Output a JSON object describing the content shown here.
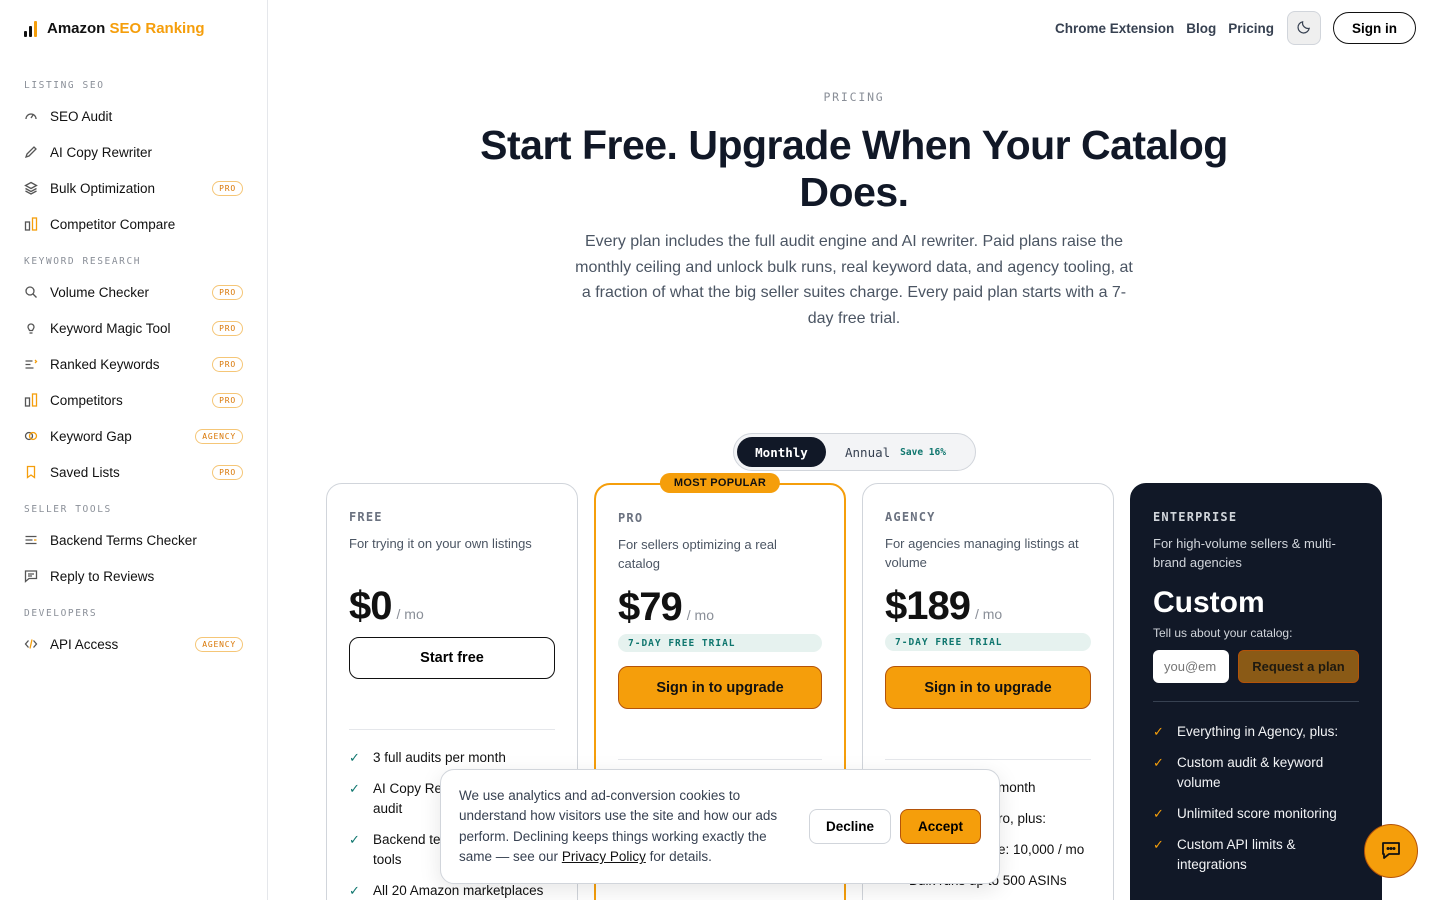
{
  "brand": {
    "name": "Amazon",
    "accent": "SEO Ranking",
    "accent_color": "#f59e0b"
  },
  "sidebar": {
    "sections": [
      {
        "label": "LISTING SEO"
      },
      {
        "label": "KEYWORD RESEARCH"
      },
      {
        "label": "SELLER TOOLS"
      },
      {
        "label": "DEVELOPERS"
      }
    ],
    "items": [
      {
        "label": "SEO Audit",
        "icon": "gauge-icon",
        "badge": ""
      },
      {
        "label": "AI Copy Rewriter",
        "icon": "pencil-icon",
        "badge": ""
      },
      {
        "label": "Bulk Optimization",
        "icon": "layers-icon",
        "badge": "PRO"
      },
      {
        "label": "Competitor Compare",
        "icon": "compare-icon",
        "badge": ""
      },
      {
        "label": "Volume Checker",
        "icon": "search-icon",
        "badge": "PRO"
      },
      {
        "label": "Keyword Magic Tool",
        "icon": "lightbulb-icon",
        "badge": "PRO"
      },
      {
        "label": "Ranked Keywords",
        "icon": "list-ranked-icon",
        "badge": "PRO"
      },
      {
        "label": "Competitors",
        "icon": "compare-icon",
        "badge": "PRO"
      },
      {
        "label": "Keyword Gap",
        "icon": "venn-icon",
        "badge": "AGENCY"
      },
      {
        "label": "Saved Lists",
        "icon": "bookmark-icon",
        "badge": "PRO"
      },
      {
        "label": "Backend Terms Checker",
        "icon": "terms-icon",
        "badge": ""
      },
      {
        "label": "Reply to Reviews",
        "icon": "message-icon",
        "badge": ""
      },
      {
        "label": "API Access",
        "icon": "code-icon",
        "badge": "AGENCY"
      }
    ]
  },
  "topnav": {
    "links": [
      "Chrome Extension",
      "Blog",
      "Pricing"
    ],
    "theme_icon": "moon-icon",
    "signin": "Sign in"
  },
  "hero": {
    "eyebrow": "PRICING",
    "title": "Start Free. Upgrade When Your Catalog Does.",
    "subtitle": "Every plan includes the full audit engine and AI rewriter. Paid plans raise the monthly ceiling and unlock bulk runs, real keyword data, and agency tooling, at a fraction of what the big seller suites charge. Every paid plan starts with a 7-day free trial."
  },
  "billing": {
    "monthly": "Monthly",
    "annual": "Annual",
    "save": "Save 16%",
    "selected": "Monthly"
  },
  "plans": {
    "free": {
      "name": "FREE",
      "desc": "For trying it on your own listings",
      "price": "$0",
      "per": "/ mo",
      "cta": "Start free",
      "features": [
        "3 full audits per month",
        "AI Copy Rewriter with each audit",
        "Backend terms & review reply tools",
        "All 20 Amazon marketplaces"
      ]
    },
    "pro": {
      "popular": "MOST POPULAR",
      "name": "PRO",
      "desc": "For sellers optimizing a real catalog",
      "price": "$79",
      "per": "/ mo",
      "trial": "7-DAY FREE TRIAL",
      "cta": "Sign in to upgrade"
    },
    "agency": {
      "name": "AGENCY",
      "desc": "For agencies managing listings at volume",
      "price": "$189",
      "per": "/ mo",
      "trial": "7-DAY FREE TRIAL",
      "cta": "Sign in to upgrade",
      "features": [
        "month",
        "ro, plus:",
        "e: 10,000 / mo",
        "Bulk runs up to 500 ASINs"
      ]
    },
    "enterprise": {
      "name": "ENTERPRISE",
      "desc": "For high-volume sellers & multi-brand agencies",
      "price": "Custom",
      "tell": "Tell us about your catalog:",
      "email_placeholder": "you@em",
      "cta": "Request a plan",
      "features": [
        "Everything in Agency, plus:",
        "Custom audit & keyword volume",
        "Unlimited score monitoring",
        "Custom API limits & integrations"
      ]
    }
  },
  "cookie": {
    "text": "We use analytics and ad-conversion cookies to understand how visitors use the site and how our ads perform. Declining keeps things working exactly the same — see our",
    "link": "Privacy Policy",
    "after": "for details.",
    "decline": "Decline",
    "accept": "Accept"
  },
  "chat": {
    "icon": "chat-icon"
  }
}
